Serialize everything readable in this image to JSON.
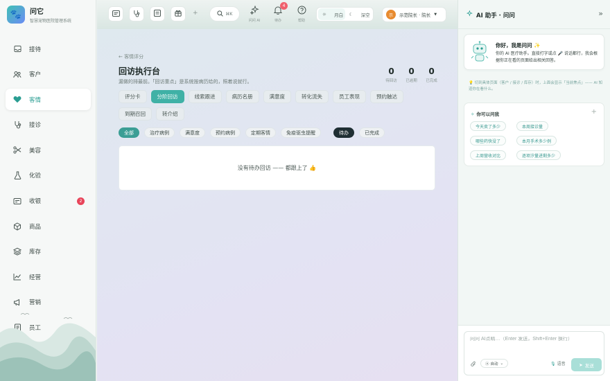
{
  "app": {
    "name": "问它",
    "subtitle": "智慧宠物医院管理系统",
    "logo_glyph": "🐾"
  },
  "sidebar": {
    "items": [
      {
        "label": "接待",
        "icon": "reception-icon"
      },
      {
        "label": "客户",
        "icon": "customers-icon"
      },
      {
        "label": "客情",
        "icon": "heart-icon",
        "active": true
      },
      {
        "label": "接诊",
        "icon": "stethoscope-icon"
      },
      {
        "label": "美容",
        "icon": "scissors-icon"
      },
      {
        "label": "化验",
        "icon": "flask-icon"
      },
      {
        "label": "收银",
        "icon": "cashier-icon",
        "badge": "2"
      },
      {
        "label": "商品",
        "icon": "box-icon"
      },
      {
        "label": "库存",
        "icon": "layers-icon"
      },
      {
        "label": "经营",
        "icon": "chart-icon"
      },
      {
        "label": "营销",
        "icon": "megaphone-icon"
      },
      {
        "label": "员工",
        "icon": "staff-icon"
      }
    ]
  },
  "topbar": {
    "search_shortcut": "⌘K",
    "icons": [
      {
        "label": "问问 AI",
        "icon": "sparkle-icon"
      },
      {
        "label": "待办",
        "icon": "bell-icon",
        "badge": "4"
      },
      {
        "label": "帮助",
        "icon": "help-icon"
      }
    ],
    "theme": {
      "light": "月白",
      "dark": "深空",
      "selected": "light"
    },
    "user": {
      "avatar": "示",
      "name": "示范院长 · 院长"
    }
  },
  "main": {
    "back_label": "← 客情评分",
    "title": "回访执行台",
    "subtitle": "漏做的排最前。「回访重点」是系统按病历给的，照着说就行。",
    "stats": [
      {
        "value": "0",
        "label": "待回访"
      },
      {
        "value": "0",
        "label": "已逾期"
      },
      {
        "value": "0",
        "label": "已完成"
      }
    ],
    "tabs": [
      "评分卡",
      "分阶回访",
      "线索跟进",
      "病历名册",
      "满意度",
      "转化流失",
      "员工表现",
      "预约触达",
      "到期召回",
      "转介绍"
    ],
    "selected_tab": "分阶回访",
    "filters": [
      "全部",
      "治疗病例",
      "满意度",
      "预约病例",
      "定期客情",
      "免疫驱虫提醒"
    ],
    "selected_filter": "全部",
    "status": [
      "待办",
      "已完成"
    ],
    "selected_status": "待办",
    "empty_text": "没有待办回访 —— 都跟上了 👍"
  },
  "ai": {
    "title": "AI 助手 · 问问",
    "collapse": "»",
    "greeting_title": "你好，我是问问 ✨",
    "greeting_desc": "你的 AI 医疗助手。直接打字或点 🎤 说话都行，我会根据你正在看的页面给出相关回答。",
    "tip": "💡 切到具体页面（客户 / 接诊 / 库存）时，上面会显示「当前焦点」—— AI 知道你在看什么。",
    "ask_title": "你可以问我",
    "questions": [
      "今天卖了多少",
      "本周接诊量",
      "哪些药快没了",
      "本月手术多少例",
      "上周营收对比",
      "逐项汐量进剩多少"
    ],
    "input_placeholder": "问问 AI点睛…（Enter 发送，Shift+Enter 换行）",
    "mode": "自动",
    "voice": "语音",
    "send": "发送"
  },
  "colors": {
    "accent": "#3fb1a6",
    "badge": "#e8455a",
    "dark_chip": "#1f2e33"
  }
}
